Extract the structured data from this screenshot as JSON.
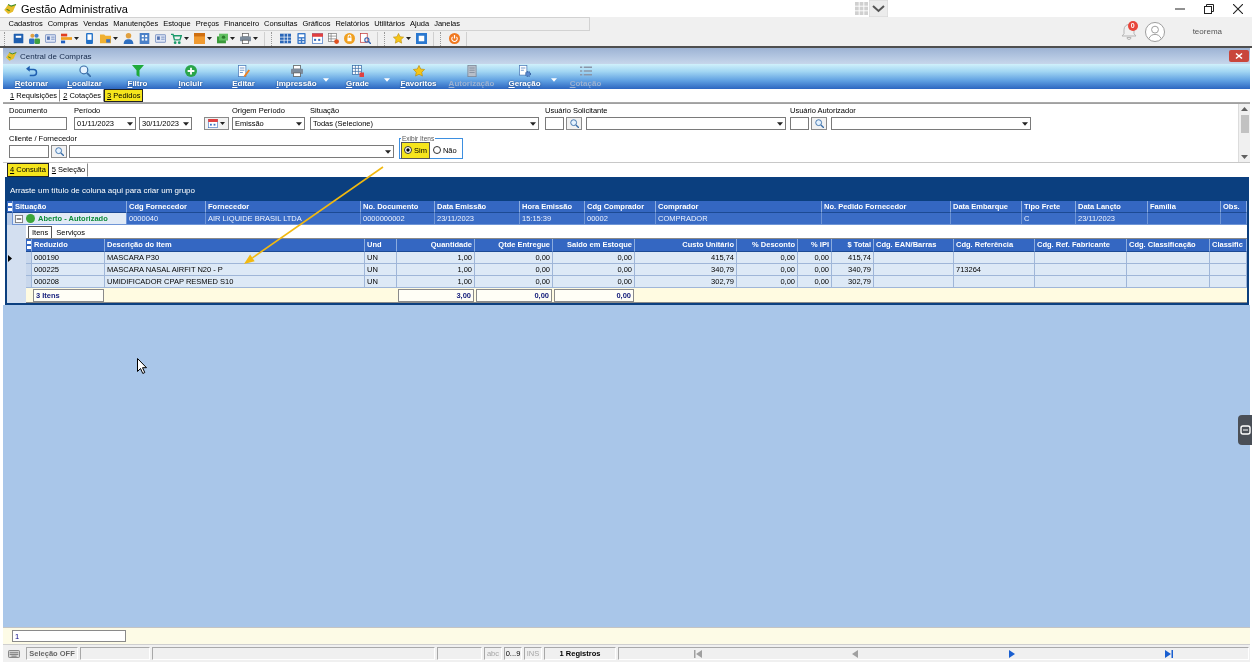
{
  "app": {
    "title": "Gestão Administrativa",
    "notification_count": "0",
    "user": "teorema"
  },
  "menu": [
    "Cadastros",
    "Compras",
    "Vendas",
    "Manutenções",
    "Estoque",
    "Preços",
    "Financeiro",
    "Consultas",
    "Gráficos",
    "Relatórios",
    "Utilitários",
    "Ajuda",
    "Janelas"
  ],
  "document": {
    "title": "Central de Compras"
  },
  "toolbar": [
    {
      "label": "Retornar",
      "disabled": false,
      "dropdown": false
    },
    {
      "label": "Localizar",
      "disabled": false,
      "dropdown": false
    },
    {
      "label": "Filtro",
      "disabled": false,
      "dropdown": false
    },
    {
      "label": "Incluir",
      "disabled": false,
      "dropdown": false
    },
    {
      "label": "Editar",
      "disabled": false,
      "dropdown": false
    },
    {
      "label": "Impressão",
      "disabled": false,
      "dropdown": true
    },
    {
      "label": "Grade",
      "disabled": false,
      "dropdown": true
    },
    {
      "label": "Favoritos",
      "disabled": false,
      "dropdown": false
    },
    {
      "label": "Autorização",
      "disabled": true,
      "dropdown": false
    },
    {
      "label": "Geração",
      "disabled": false,
      "dropdown": true
    },
    {
      "label": "Cotação",
      "disabled": true,
      "dropdown": false
    }
  ],
  "page_tabs": [
    {
      "label": "1 Requisições",
      "selected": false,
      "highlighted": false
    },
    {
      "label": "2 Cotações",
      "selected": false,
      "highlighted": false
    },
    {
      "label": "3 Pedidos",
      "selected": true,
      "highlighted": true
    }
  ],
  "filters": {
    "documento": {
      "label": "Documento"
    },
    "periodo": {
      "label": "Período",
      "from": "01/11/2023",
      "to": "30/11/2023"
    },
    "origem_periodo": {
      "label": "Origem Período",
      "value": "Emissão"
    },
    "situacao": {
      "label": "Situação",
      "value": "Todas (Selecione)"
    },
    "usuario_solicitante": {
      "label": "Usuário Solicitante"
    },
    "usuario_autorizador": {
      "label": "Usuário Autorizador"
    },
    "cliente_fornecedor": {
      "label": "Cliente / Fornecedor"
    },
    "exibir_itens": {
      "label": "Exibir Itens",
      "options": [
        {
          "label": "Sim",
          "selected": true,
          "highlighted": true
        },
        {
          "label": "Não",
          "selected": false,
          "highlighted": false
        }
      ]
    }
  },
  "view_tabs": [
    {
      "label": "4 Consulta",
      "selected": true,
      "highlighted": true
    },
    {
      "label": "5 Seleção",
      "selected": false,
      "highlighted": false
    }
  ],
  "grid": {
    "group_hint": "Arraste um título de coluna aqui para criar um grupo",
    "columns": [
      {
        "label": "Situação"
      },
      {
        "label": "Cdg Fornecedor"
      },
      {
        "label": "Fornecedor"
      },
      {
        "label": "No. Documento"
      },
      {
        "label": "Data Emissão"
      },
      {
        "label": "Hora Emissão"
      },
      {
        "label": "Cdg Comprador"
      },
      {
        "label": "Comprador"
      },
      {
        "label": "No. Pedido Fornecedor"
      },
      {
        "label": "Data Embarque"
      },
      {
        "label": "Tipo Frete"
      },
      {
        "label": "Data Lançto"
      },
      {
        "label": "Família"
      },
      {
        "label": "Obs."
      }
    ],
    "rows": [
      {
        "selected": true,
        "expanded": true,
        "color": "#3aa53a",
        "cells": [
          "Aberto - Autorizado",
          "0000040",
          "AIR LIQUIDE BRASIL LTDA",
          "0000000002",
          "23/11/2023",
          "15:15:39",
          "00002",
          "COMPRADOR",
          null,
          null,
          "C",
          "23/11/2023",
          null,
          null
        ]
      }
    ],
    "detail": {
      "tabs": [
        {
          "label": "Itens",
          "selected": true
        },
        {
          "label": "Serviços",
          "selected": false
        }
      ],
      "columns": [
        {
          "label": "Reduzido",
          "kind": "text"
        },
        {
          "label": "Descrição do Item",
          "kind": "text"
        },
        {
          "label": "Und",
          "kind": "text"
        },
        {
          "label": "Quantidade",
          "kind": "number"
        },
        {
          "label": "Qtde Entregue",
          "kind": "number"
        },
        {
          "label": "Saldo em Estoque",
          "kind": "number"
        },
        {
          "label": "Custo Unitário",
          "kind": "number"
        },
        {
          "label": "% Desconto",
          "kind": "number"
        },
        {
          "label": "% IPI",
          "kind": "number"
        },
        {
          "label": "$ Total",
          "kind": "number"
        },
        {
          "label": "Cdg. EAN/Barras",
          "kind": "text"
        },
        {
          "label": "Cdg. Referência",
          "kind": "text"
        },
        {
          "label": "Cdg. Ref. Fabricante",
          "kind": "text"
        },
        {
          "label": "Cdg. Classificação",
          "kind": "text"
        },
        {
          "label": "Classific",
          "kind": "text"
        }
      ],
      "rows": [
        {
          "current": true,
          "cells": [
            "000190",
            "MASCARA P30",
            "UN",
            "1,00",
            "0,00",
            "0,00",
            "415,74",
            "0,00",
            "0,00",
            "415,74",
            null,
            null,
            null,
            null,
            null
          ]
        },
        {
          "current": false,
          "cells": [
            "000225",
            "MASCARA NASAL AIRFIT N20 - P",
            "UN",
            "1,00",
            "0,00",
            "0,00",
            "340,79",
            "0,00",
            "0,00",
            "340,79",
            null,
            "713264",
            null,
            null,
            null
          ]
        },
        {
          "current": false,
          "cells": [
            "000208",
            "UMIDIFICADOR CPAP RESMED S10",
            "UN",
            "1,00",
            "0,00",
            "0,00",
            "302,79",
            "0,00",
            "0,00",
            "302,79",
            null,
            null,
            null,
            null,
            null
          ]
        }
      ],
      "footer": {
        "count": "3 Itens",
        "totals": [
          "3,00",
          "0,00",
          "0,00"
        ]
      }
    }
  },
  "find_bar": {
    "value": "1"
  },
  "status_bar": {
    "selection": "Seleção OFF",
    "indicators": [
      {
        "label": "abc",
        "disabled": true
      },
      {
        "label": "0...9",
        "disabled": false
      },
      {
        "label": "INS",
        "disabled": true
      }
    ],
    "records": "1 Registros",
    "navigation": [
      {
        "kind": "first",
        "disabled": true
      },
      {
        "kind": "previous",
        "disabled": true
      },
      {
        "kind": "next",
        "disabled": false
      },
      {
        "kind": "last",
        "disabled": false
      }
    ]
  }
}
